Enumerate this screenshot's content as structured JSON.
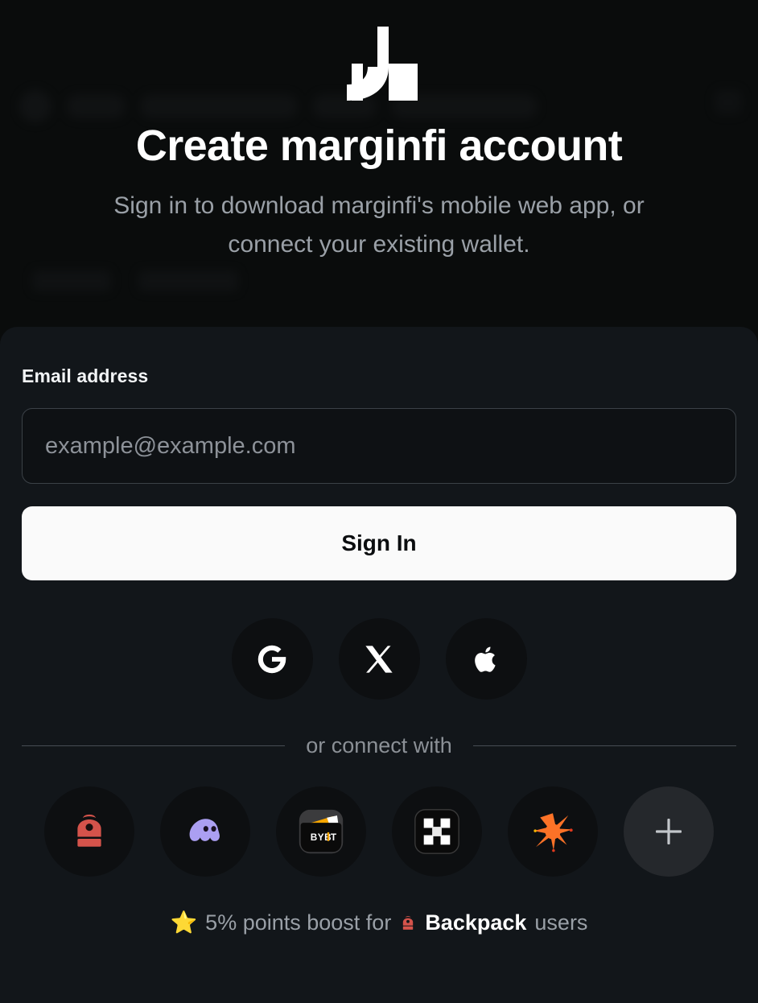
{
  "colors": {
    "page_bg": "#0a0c0c",
    "panel_bg": "#12161a",
    "accent_white": "#fafafa",
    "muted_text": "#9aa0a7",
    "backpack_red": "#d4534b",
    "phantom_purple": "#ab9ff2",
    "solflare_orange": "#fc7227",
    "bybit_gold": "#f7a600",
    "star_yellow": "#f7c948"
  },
  "hero": {
    "logo_name": "marginfi-logo",
    "title": "Create marginfi account",
    "subtitle": "Sign in to download marginfi's mobile web app, or connect your existing wallet."
  },
  "form": {
    "email_label": "Email address",
    "email_placeholder": "example@example.com",
    "email_value": "",
    "submit_label": "Sign In"
  },
  "social_providers": [
    {
      "name": "google",
      "label": "Sign in with Google",
      "icon": "google-icon"
    },
    {
      "name": "x",
      "label": "Sign in with X",
      "icon": "x-icon"
    },
    {
      "name": "apple",
      "label": "Sign in with Apple",
      "icon": "apple-icon"
    }
  ],
  "divider": {
    "label": "or connect with"
  },
  "wallets": [
    {
      "name": "backpack",
      "label": "Backpack",
      "icon": "backpack-icon"
    },
    {
      "name": "phantom",
      "label": "Phantom",
      "icon": "phantom-icon"
    },
    {
      "name": "bybit",
      "label": "Bybit Wallet",
      "icon": "bybit-icon"
    },
    {
      "name": "okx",
      "label": "OKX Wallet",
      "icon": "okx-icon"
    },
    {
      "name": "solflare",
      "label": "Solflare",
      "icon": "solflare-icon"
    },
    {
      "name": "more",
      "label": "More wallets",
      "icon": "plus-icon"
    }
  ],
  "boost": {
    "star_icon": "star-icon",
    "text_before": "5% points boost for",
    "brand_icon": "backpack-icon",
    "brand": "Backpack",
    "text_after": "users"
  }
}
